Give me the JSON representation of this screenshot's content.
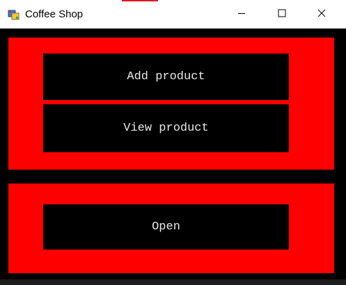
{
  "window": {
    "title": "Coffee Shop",
    "icon": "app-window-icon",
    "controls": {
      "minimize_icon": "minimize-icon",
      "maximize_icon": "maximize-icon",
      "close_icon": "close-icon"
    }
  },
  "top_panel": {
    "add_product_label": "Add product",
    "view_product_label": "View product"
  },
  "bottom_panel": {
    "open_label": "Open"
  },
  "colors": {
    "panel_background": "#ff0000",
    "button_background": "#000000",
    "button_text": "#e8e8e8",
    "form_background": "#000000"
  }
}
